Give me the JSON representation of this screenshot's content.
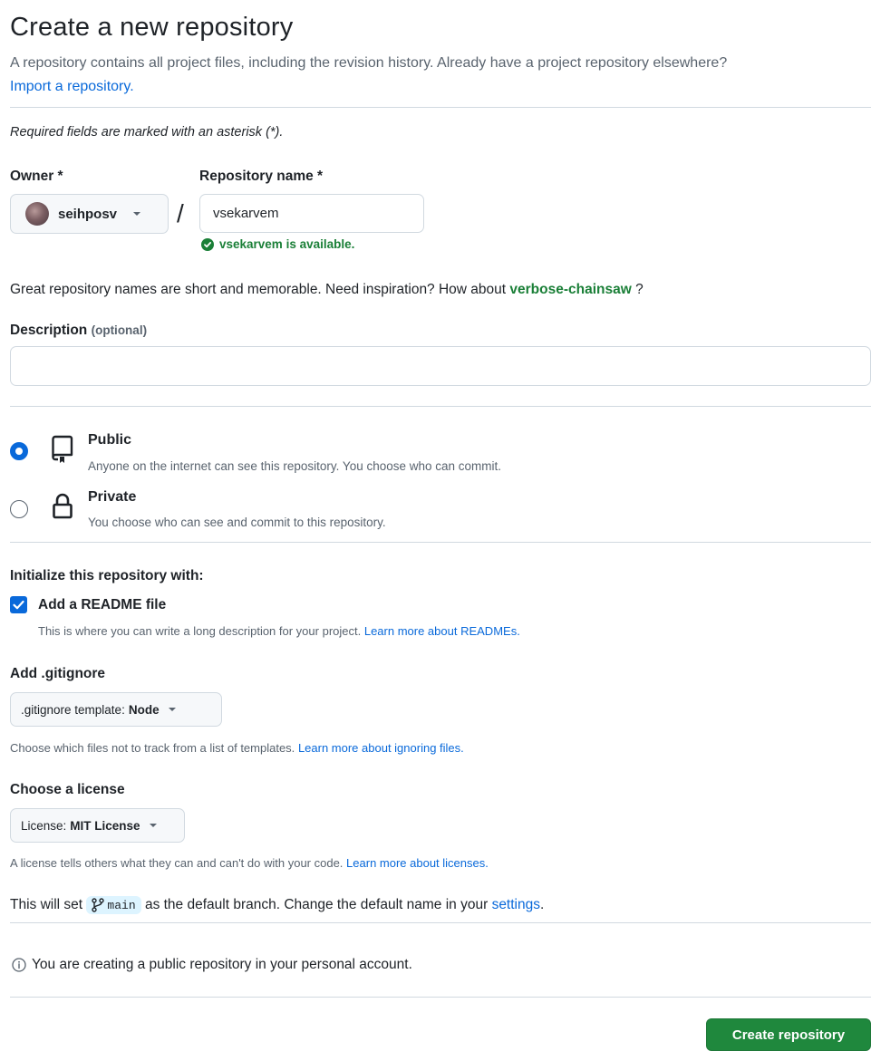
{
  "header": {
    "title": "Create a new repository",
    "subtitle": "A repository contains all project files, including the revision history. Already have a project repository elsewhere?",
    "import_link": "Import a repository."
  },
  "required_note": "Required fields are marked with an asterisk (*).",
  "owner": {
    "label": "Owner *",
    "value": "seihposv"
  },
  "separator": "/",
  "repo_name": {
    "label": "Repository name *",
    "value": "vsekarvem",
    "availability": "vsekarvem is available."
  },
  "inspiration": {
    "text": "Great repository names are short and memorable. Need inspiration? How about",
    "suggestion": "verbose-chainsaw",
    "suffix": "?"
  },
  "description": {
    "label": "Description",
    "optional": "(optional)",
    "value": "",
    "placeholder": ""
  },
  "visibility": {
    "public": {
      "title": "Public",
      "desc": "Anyone on the internet can see this repository. You choose who can commit.",
      "selected": true
    },
    "private": {
      "title": "Private",
      "desc": "You choose who can see and commit to this repository.",
      "selected": false
    }
  },
  "initialize": {
    "heading": "Initialize this repository with:",
    "readme": {
      "label": "Add a README file",
      "checked": true,
      "desc": "This is where you can write a long description for your project.",
      "link": "Learn more about READMEs."
    }
  },
  "gitignore": {
    "heading": "Add .gitignore",
    "button_prefix": ".gitignore template:",
    "button_value": "Node",
    "desc": "Choose which files not to track from a list of templates.",
    "link": "Learn more about ignoring files."
  },
  "license": {
    "heading": "Choose a license",
    "button_prefix": "License:",
    "button_value": "MIT License",
    "desc": "A license tells others what they can and can't do with your code.",
    "link": "Learn more about licenses."
  },
  "branch": {
    "prefix": "This will set",
    "name": "main",
    "middle": "as the default branch. Change the default name in your",
    "link": "settings",
    "suffix": "."
  },
  "notice": "You are creating a public repository in your personal account.",
  "submit_label": "Create repository",
  "colors": {
    "primary_button": "#1f883d",
    "link": "#0969da",
    "success": "#1a7f37",
    "radio_selected": "#0969da"
  }
}
